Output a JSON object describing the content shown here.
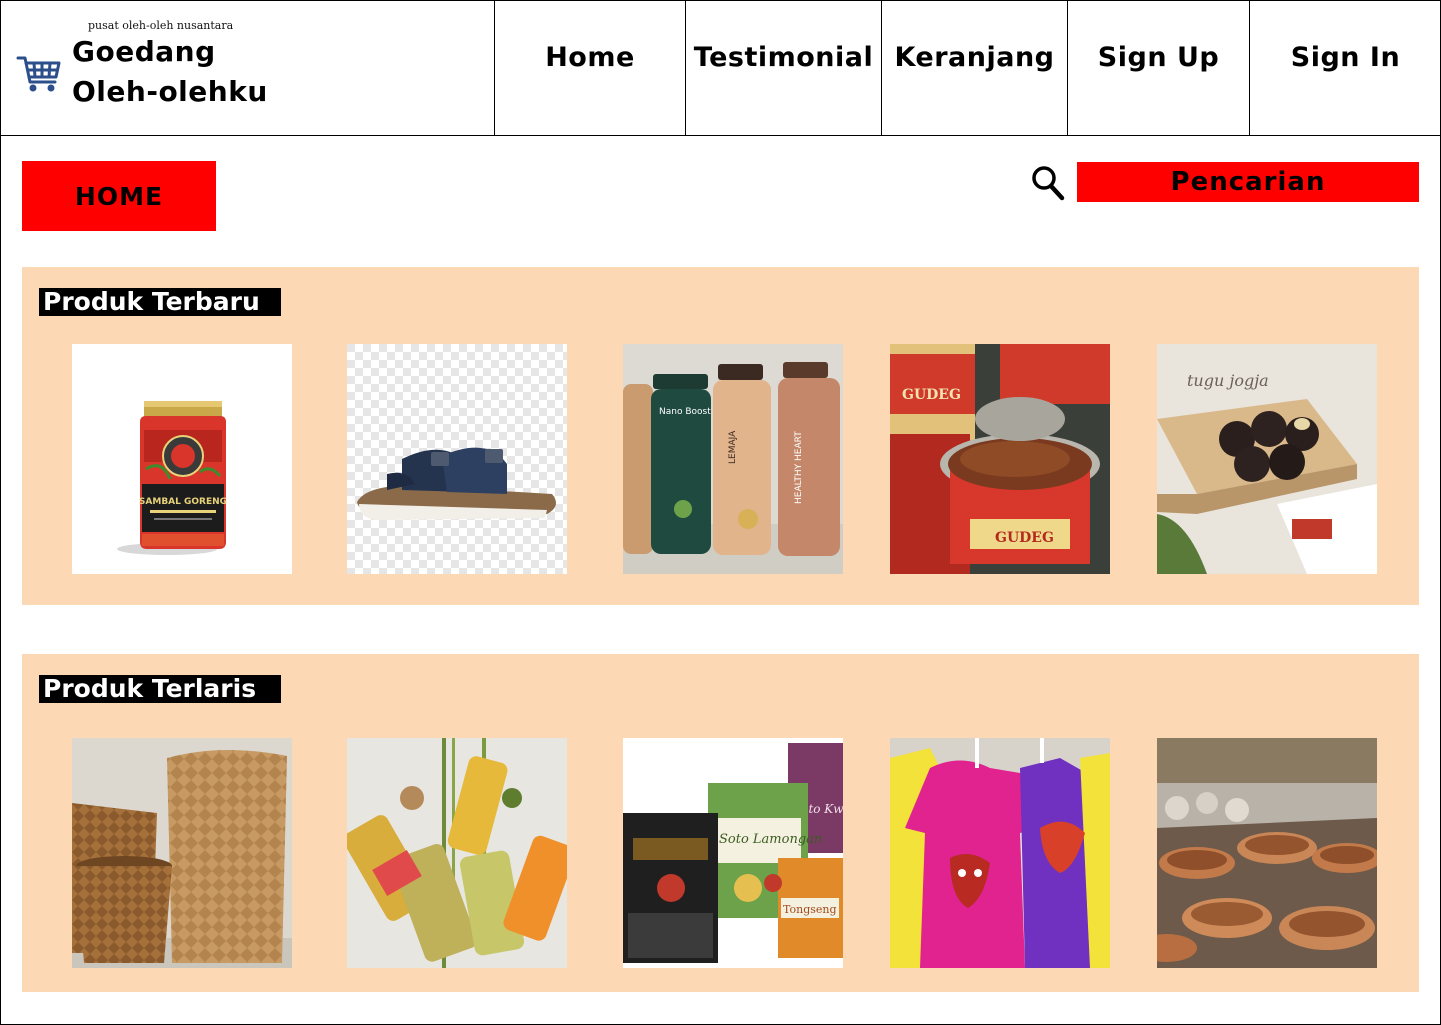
{
  "brand": {
    "tagline": "pusat oleh-oleh nusantara",
    "title_line1": "Goedang",
    "title_line2": "Oleh-olehku",
    "icon": "shopping-cart-icon"
  },
  "nav": {
    "home": "Home",
    "testimonial": "Testimonial",
    "cart": "Keranjang",
    "signup": "Sign Up",
    "signin": "Sign In"
  },
  "toolbar": {
    "home_button": "HOME",
    "search_placeholder": "Pencarian",
    "search_icon": "magnifier-icon"
  },
  "sections": {
    "newest": {
      "title": "Produk Terbaru",
      "products": [
        "sambal-goreng-jar",
        "sandals",
        "bottled-drinks",
        "canned-gudeg",
        "chocolate-bakpia"
      ]
    },
    "bestseller": {
      "title": " Produk Terlaris",
      "products": [
        "woven-baskets",
        "seasoning-bottles",
        "instant-spice-packs",
        "batik-shirts",
        "clay-pottery"
      ]
    }
  },
  "colors": {
    "accent_red": "#ff0000",
    "section_bg": "#fdd8b4",
    "cart_icon": "#2c4f8c"
  },
  "product_labels": {
    "sambal_label": "SAMBAL GORENG",
    "gudeg_label": "GUDEG",
    "nano_boost": "Nano Boost",
    "lemaja": "LEMAJA",
    "healthy_heart": "HEALTHY HEART",
    "tugu_jogja": "tugu jogja",
    "soto_lamongan": "Soto Lamongan",
    "soto_kwali": "Soto Kwali",
    "tongseng": "Tongseng"
  }
}
